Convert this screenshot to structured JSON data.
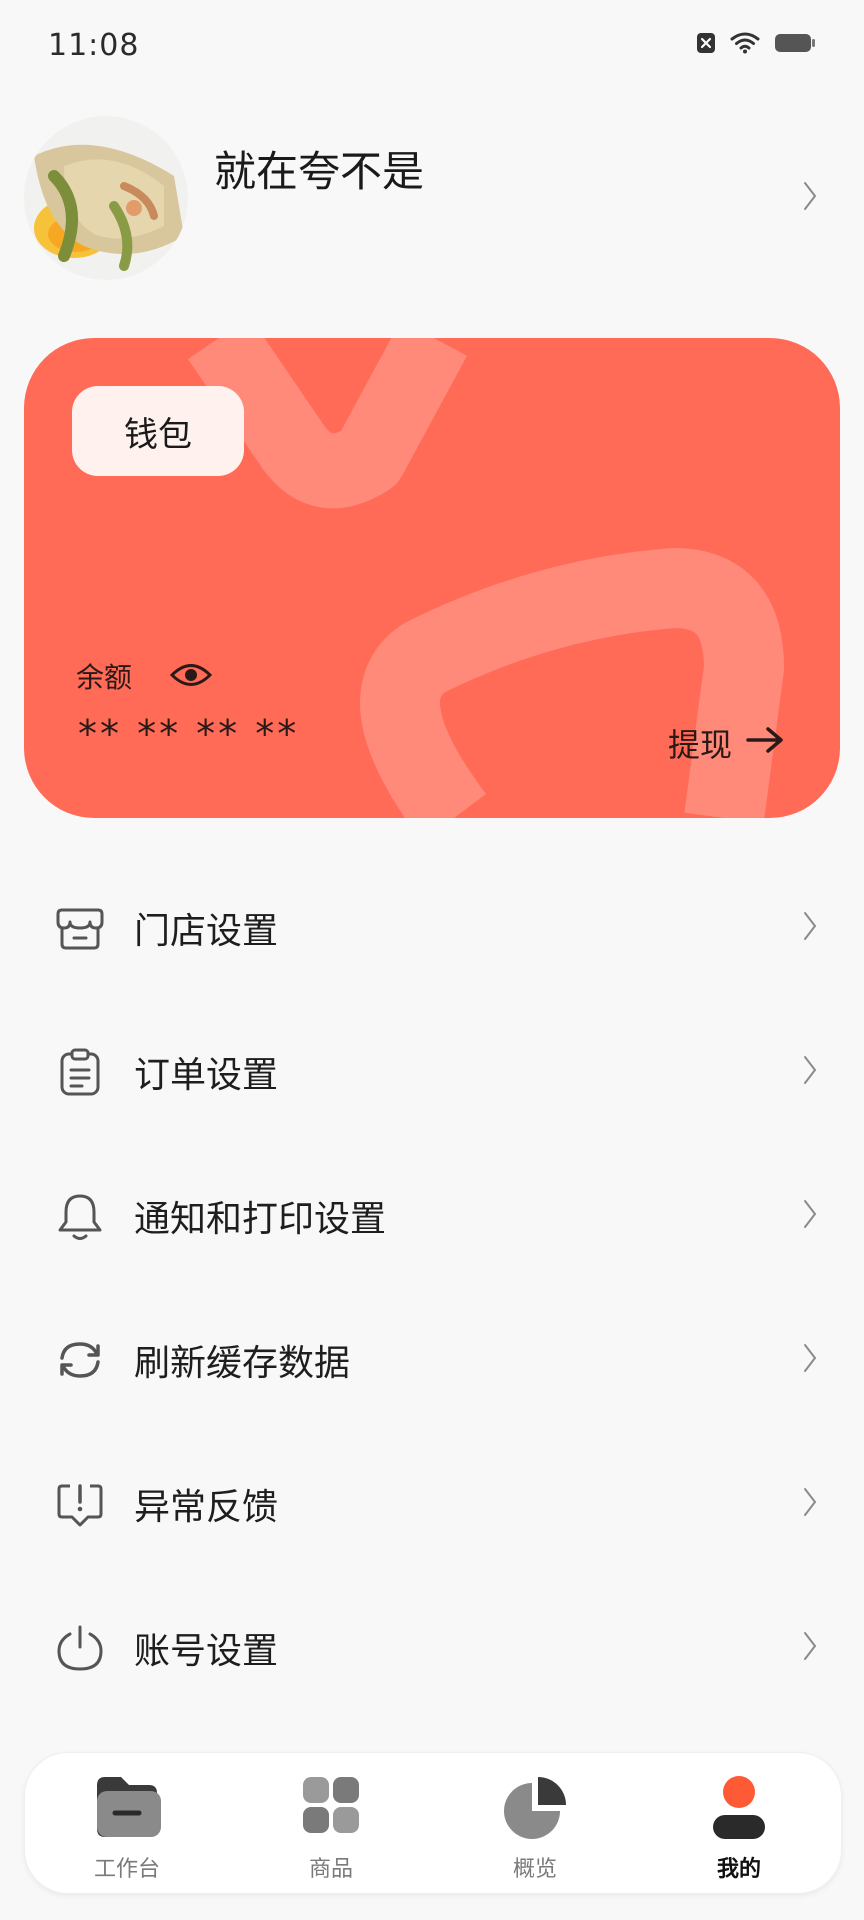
{
  "status_bar": {
    "time": "11:08",
    "icons": [
      "sim-off-icon",
      "wifi-icon",
      "battery-icon"
    ]
  },
  "profile": {
    "username": "就在夸不是"
  },
  "wallet": {
    "tag_label": "钱包",
    "balance_label": "余额",
    "balance_value": "** ** ** **",
    "withdraw_label": "提现",
    "colors": {
      "card": "#ff6b57",
      "decoration": "#ff8a7a",
      "tag_bg": "#fff1ee"
    }
  },
  "menu": {
    "items": [
      {
        "label": "门店设置",
        "icon": "store-icon"
      },
      {
        "label": "订单设置",
        "icon": "clipboard-icon"
      },
      {
        "label": "通知和打印设置",
        "icon": "bell-icon"
      },
      {
        "label": "刷新缓存数据",
        "icon": "refresh-icon"
      },
      {
        "label": "异常反馈",
        "icon": "feedback-icon"
      },
      {
        "label": "账号设置",
        "icon": "power-icon"
      }
    ]
  },
  "tab_bar": {
    "tabs": [
      {
        "label": "工作台",
        "icon": "folder-icon",
        "active": false
      },
      {
        "label": "商品",
        "icon": "grid-icon",
        "active": false
      },
      {
        "label": "概览",
        "icon": "pie-chart-icon",
        "active": false
      },
      {
        "label": "我的",
        "icon": "user-icon",
        "active": true
      }
    ],
    "accent": "#ff5a36"
  }
}
